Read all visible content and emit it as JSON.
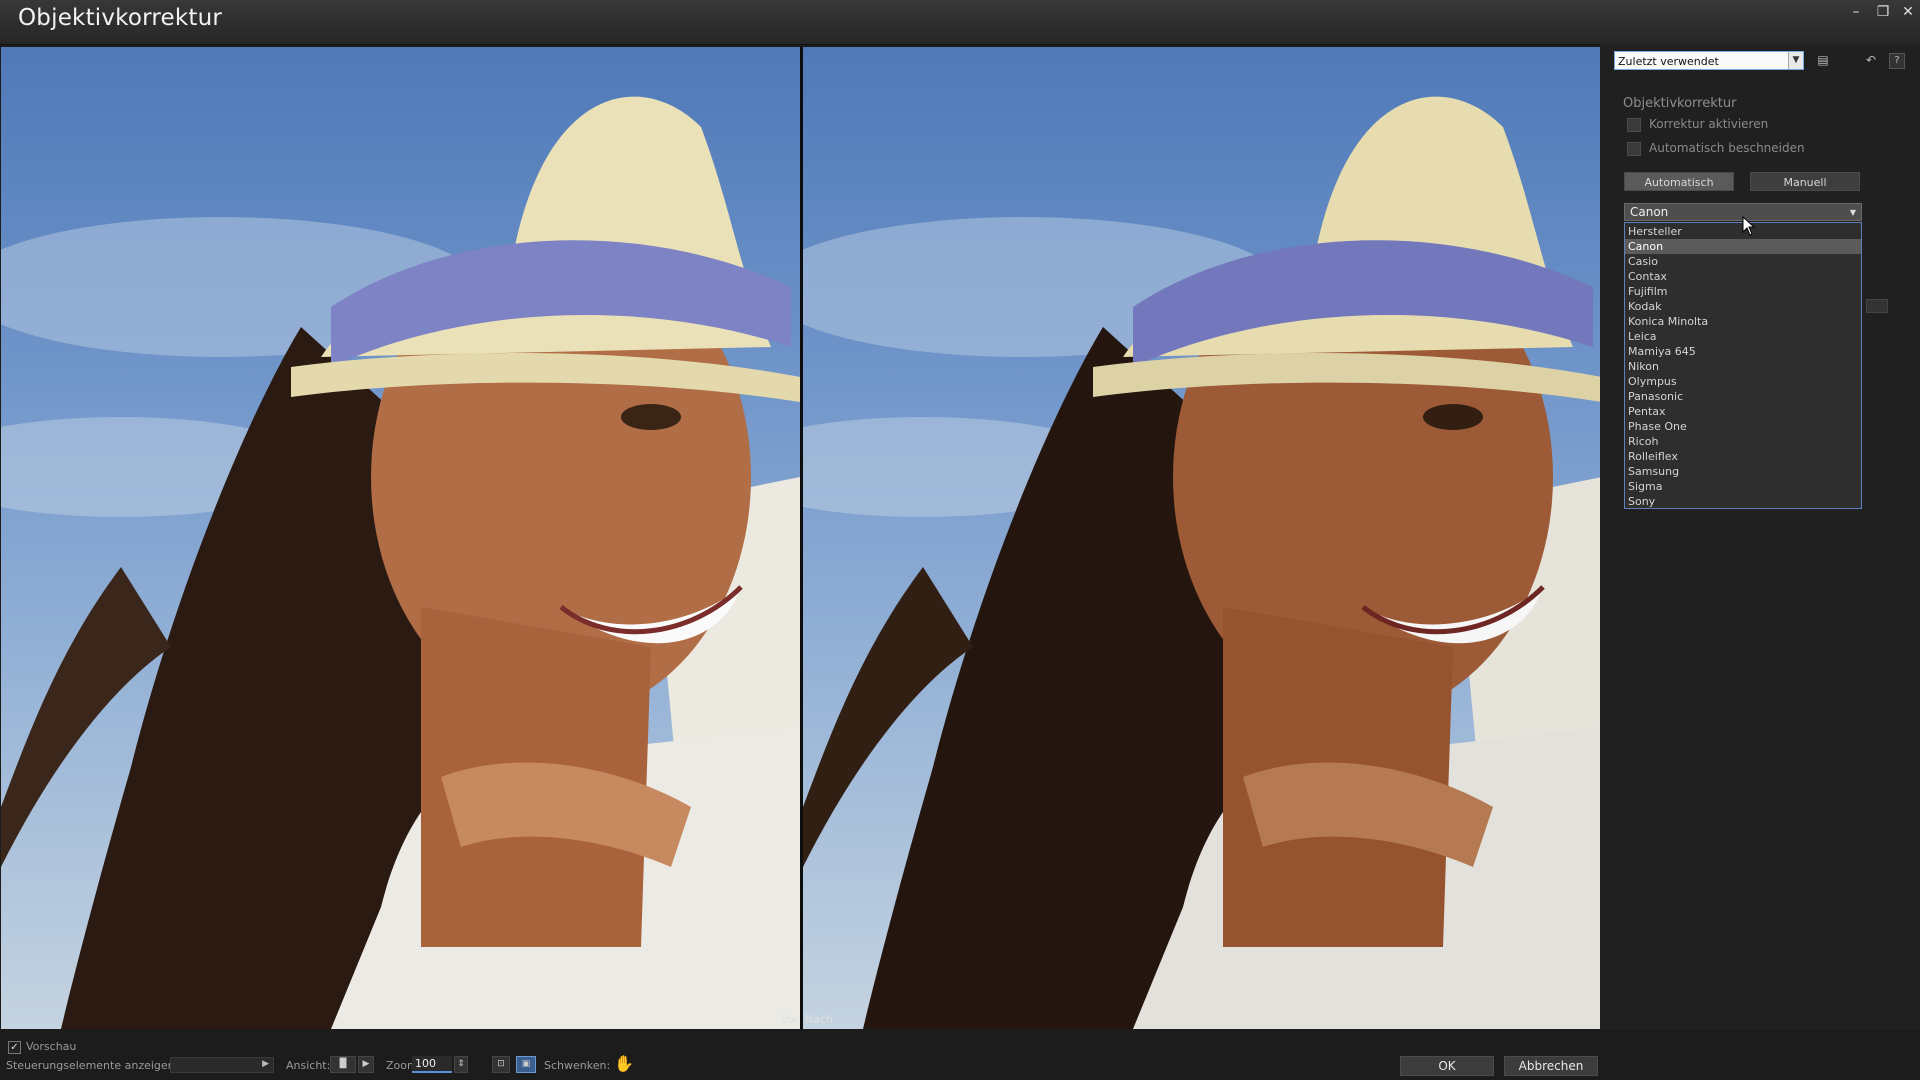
{
  "window": {
    "title": "Objektivkorrektur",
    "controls": {
      "minimize": "–",
      "maximize": "❐",
      "close": "✕"
    }
  },
  "preview": {
    "before_label": "Vor",
    "after_label": "Nach"
  },
  "panel": {
    "preset": {
      "value": "Zuletzt verwendet"
    },
    "section_title": "Objektivkorrektur",
    "checkboxes": [
      {
        "label": "Korrektur aktivieren",
        "checked": false
      },
      {
        "label": "Automatisch beschneiden",
        "checked": false
      }
    ],
    "mode_buttons": {
      "auto": "Automatisch",
      "manual": "Manuell"
    },
    "manufacturer": {
      "selected": "Canon",
      "options": [
        "Hersteller",
        "Canon",
        "Casio",
        "Contax",
        "Fujifilm",
        "Kodak",
        "Konica Minolta",
        "Leica",
        "Mamiya 645",
        "Nikon",
        "Olympus",
        "Panasonic",
        "Pentax",
        "Phase One",
        "Ricoh",
        "Rolleiflex",
        "Samsung",
        "Sigma",
        "Sony"
      ]
    }
  },
  "statusbar": {
    "vorschau": "Vorschau",
    "show_controls_label": "Steuerungselemente anzeigen:",
    "view_label": "Ansicht:",
    "zoom_label": "Zoom",
    "zoom_value": "100",
    "pan_label": "Schwenken:",
    "ok": "OK",
    "cancel": "Abbrechen"
  },
  "colors": {
    "accent": "#5b8fd6",
    "background": "#1c1c1c",
    "panel": "#202020"
  }
}
